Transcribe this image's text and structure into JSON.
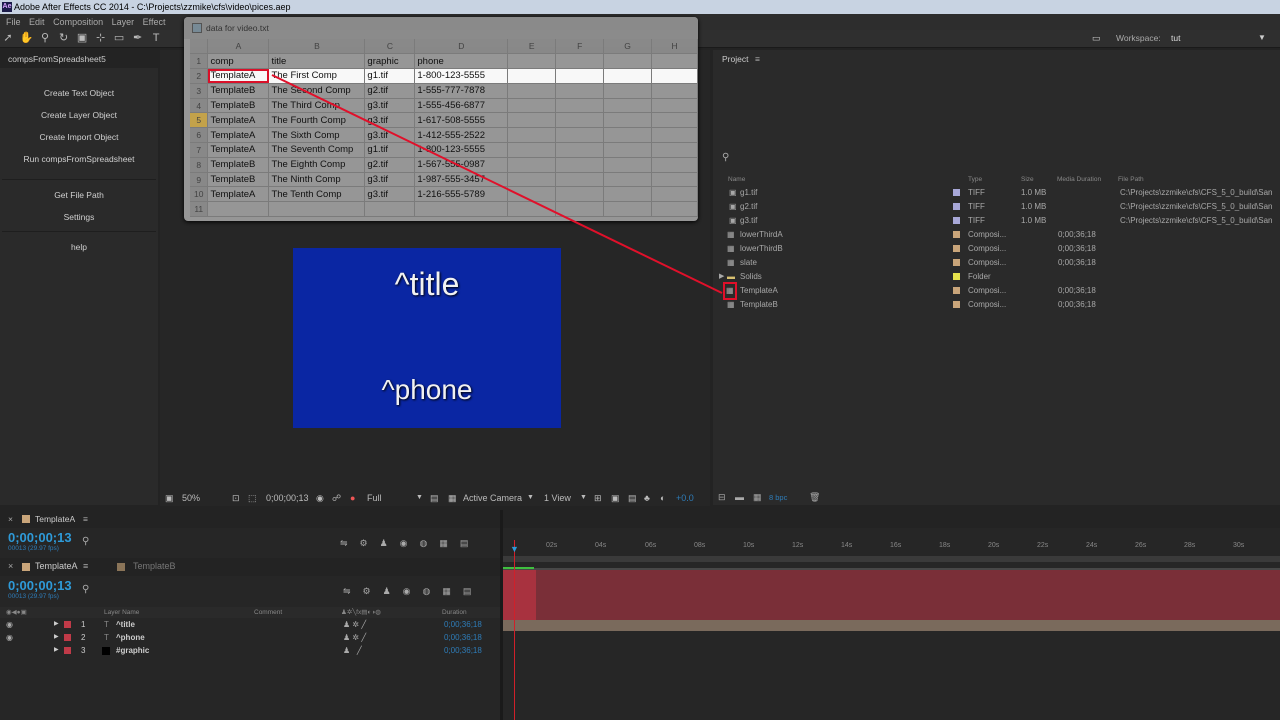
{
  "window": {
    "title": "Adobe After Effects CC 2014 - C:\\Projects\\zzmike\\cfs\\video\\pices.aep"
  },
  "menu": [
    "File",
    "Edit",
    "Composition",
    "Layer",
    "Effect"
  ],
  "workspace": {
    "label": "Workspace:",
    "value": "tut"
  },
  "left_panel": {
    "title": "compsFromSpreadsheet5",
    "buttons": [
      "Create Text Object",
      "Create Layer Object",
      "Create Import Object",
      "Run compsFromSpreadsheet",
      "Get File Path",
      "Settings",
      "help"
    ]
  },
  "spreadsheet": {
    "title": "data for video.txt",
    "columns": [
      "A",
      "B",
      "C",
      "D",
      "E",
      "F",
      "G",
      "H"
    ],
    "rows": [
      [
        "1",
        "comp",
        "title",
        "graphic",
        "phone"
      ],
      [
        "2",
        "TemplateA",
        "The First Comp",
        "g1.tif",
        "1-800-123-5555"
      ],
      [
        "3",
        "TemplateB",
        "The Second Comp",
        "g2.tif",
        "1-555-777-7878"
      ],
      [
        "4",
        "TemplateB",
        "The Third Comp",
        "g3.tif",
        "1-555-456-6877"
      ],
      [
        "5",
        "TemplateA",
        "The Fourth Comp",
        "g3.tif",
        "1-617-508-5555"
      ],
      [
        "6",
        "TemplateA",
        "The Sixth Comp",
        "g3.tif",
        "1-412-555-2522"
      ],
      [
        "7",
        "TemplateA",
        "The Seventh Comp",
        "g1.tif",
        "1-800-123-5555"
      ],
      [
        "8",
        "TemplateB",
        "The Eighth Comp",
        "g2.tif",
        "1-567-555-0987"
      ],
      [
        "9",
        "TemplateB",
        "The Ninth Comp",
        "g3.tif",
        "1-987-555-3457"
      ],
      [
        "10",
        "TemplateA",
        "The Tenth Comp",
        "g3.tif",
        "1-216-555-5789"
      ],
      [
        "11",
        "",
        "",
        "",
        ""
      ]
    ]
  },
  "composition": {
    "title_text": "^title",
    "phone_text": "^phone",
    "bg_color": "#0a26a3"
  },
  "viewer": {
    "zoom": "50%",
    "timecode": "0;00;00;13",
    "resolution": "Full",
    "camera": "Active Camera",
    "views": "1 View",
    "exposure": "+0.0"
  },
  "project": {
    "title": "Project",
    "columns": [
      "Name",
      "Type",
      "Size",
      "Media Duration",
      "File Path"
    ],
    "items": [
      {
        "name": "g1.tif",
        "type": "TIFF",
        "size": "1.0 MB",
        "duration": "",
        "path": "C:\\Projects\\zzmike\\cfs\\CFS_5_0_build\\San",
        "color": "#a8a8d8"
      },
      {
        "name": "g2.tif",
        "type": "TIFF",
        "size": "1.0 MB",
        "duration": "",
        "path": "C:\\Projects\\zzmike\\cfs\\CFS_5_0_build\\San",
        "color": "#a8a8d8"
      },
      {
        "name": "g3.tif",
        "type": "TIFF",
        "size": "1.0 MB",
        "duration": "",
        "path": "C:\\Projects\\zzmike\\cfs\\CFS_5_0_build\\San",
        "color": "#a8a8d8"
      },
      {
        "name": "lowerThirdA",
        "type": "Composi...",
        "size": "",
        "duration": "0;00;36;18",
        "path": "",
        "color": "#c9a57a"
      },
      {
        "name": "lowerThirdB",
        "type": "Composi...",
        "size": "",
        "duration": "0;00;36;18",
        "path": "",
        "color": "#c9a57a"
      },
      {
        "name": "slate",
        "type": "Composi...",
        "size": "",
        "duration": "0;00;36;18",
        "path": "",
        "color": "#c9a57a"
      },
      {
        "name": "Solids",
        "type": "Folder",
        "size": "",
        "duration": "",
        "path": "",
        "color": "#e6e24c"
      },
      {
        "name": "TemplateA",
        "type": "Composi...",
        "size": "",
        "duration": "0;00;36;18",
        "path": "",
        "color": "#c9a57a"
      },
      {
        "name": "TemplateB",
        "type": "Composi...",
        "size": "",
        "duration": "0;00;36;18",
        "path": "",
        "color": "#c9a57a"
      }
    ],
    "bpc": "8 bpc"
  },
  "timeline": {
    "tab_a": "TemplateA",
    "tab_b": "TemplateB",
    "timecode": "0;00;00;13",
    "frame_info": "00013 (29.97 fps)",
    "ruler": [
      "02s",
      "04s",
      "06s",
      "08s",
      "10s",
      "12s",
      "14s",
      "16s",
      "18s",
      "20s",
      "22s",
      "24s",
      "26s",
      "28s",
      "30s"
    ],
    "columns": {
      "layer_name": "Layer Name",
      "comment": "Comment",
      "duration": "Duration"
    },
    "layers": [
      {
        "num": "1",
        "name": "^title",
        "duration": "0;00;36;18"
      },
      {
        "num": "2",
        "name": "^phone",
        "duration": "0;00;36;18"
      },
      {
        "num": "3",
        "name": "#graphic",
        "duration": "0;00;36;18"
      }
    ]
  }
}
